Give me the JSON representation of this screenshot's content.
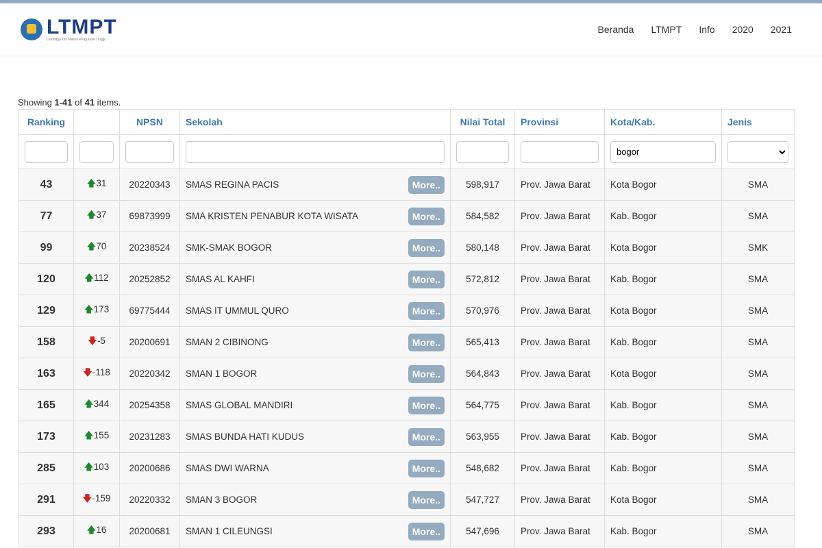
{
  "brand": {
    "name": "LTMPT",
    "tagline": "Lembaga Tes Masuk Perguruan Tinggi"
  },
  "nav": [
    "Beranda",
    "LTMPT",
    "Info",
    "2020",
    "2021"
  ],
  "summary": {
    "pre": "Showing ",
    "range": "1-41",
    "mid": " of ",
    "total": "41",
    "post": " items."
  },
  "columns": [
    "Ranking",
    "",
    "NPSN",
    "Sekolah",
    "Nilai Total",
    "Provinsi",
    "Kota/Kab.",
    "Jenis"
  ],
  "filters": {
    "kota": "bogor"
  },
  "more_label": "More..",
  "rows": [
    [
      "43",
      "up",
      "31",
      "20220343",
      "SMAS REGINA PACIS",
      "598,917",
      "Prov. Jawa Barat",
      "Kota Bogor",
      "SMA"
    ],
    [
      "77",
      "up",
      "37",
      "69873999",
      "SMA KRISTEN PENABUR KOTA WISATA",
      "584,582",
      "Prov. Jawa Barat",
      "Kab. Bogor",
      "SMA"
    ],
    [
      "99",
      "up",
      "70",
      "20238524",
      "SMK-SMAK BOGOR",
      "580,148",
      "Prov. Jawa Barat",
      "Kota Bogor",
      "SMK"
    ],
    [
      "120",
      "up",
      "112",
      "20252852",
      "SMAS AL KAHFI",
      "572,812",
      "Prov. Jawa Barat",
      "Kab. Bogor",
      "SMA"
    ],
    [
      "129",
      "up",
      "173",
      "69775444",
      "SMAS IT UMMUL QURO",
      "570,976",
      "Prov. Jawa Barat",
      "Kota Bogor",
      "SMA"
    ],
    [
      "158",
      "down",
      "-5",
      "20200691",
      "SMAN 2 CIBINONG",
      "565,413",
      "Prov. Jawa Barat",
      "Kab. Bogor",
      "SMA"
    ],
    [
      "163",
      "down",
      "-118",
      "20220342",
      "SMAN 1 BOGOR",
      "564,843",
      "Prov. Jawa Barat",
      "Kota Bogor",
      "SMA"
    ],
    [
      "165",
      "up",
      "344",
      "20254358",
      "SMAS GLOBAL MANDIRI",
      "564,775",
      "Prov. Jawa Barat",
      "Kab. Bogor",
      "SMA"
    ],
    [
      "173",
      "up",
      "155",
      "20231283",
      "SMAS BUNDA HATI KUDUS",
      "563,955",
      "Prov. Jawa Barat",
      "Kab. Bogor",
      "SMA"
    ],
    [
      "285",
      "up",
      "103",
      "20200686",
      "SMAS DWI WARNA",
      "548,682",
      "Prov. Jawa Barat",
      "Kab. Bogor",
      "SMA"
    ],
    [
      "291",
      "down",
      "-159",
      "20220332",
      "SMAN 3 BOGOR",
      "547,727",
      "Prov. Jawa Barat",
      "Kota Bogor",
      "SMA"
    ],
    [
      "293",
      "up",
      "16",
      "20200681",
      "SMAN 1 CILEUNGSI",
      "547,696",
      "Prov. Jawa Barat",
      "Kab. Bogor",
      "SMA"
    ]
  ]
}
